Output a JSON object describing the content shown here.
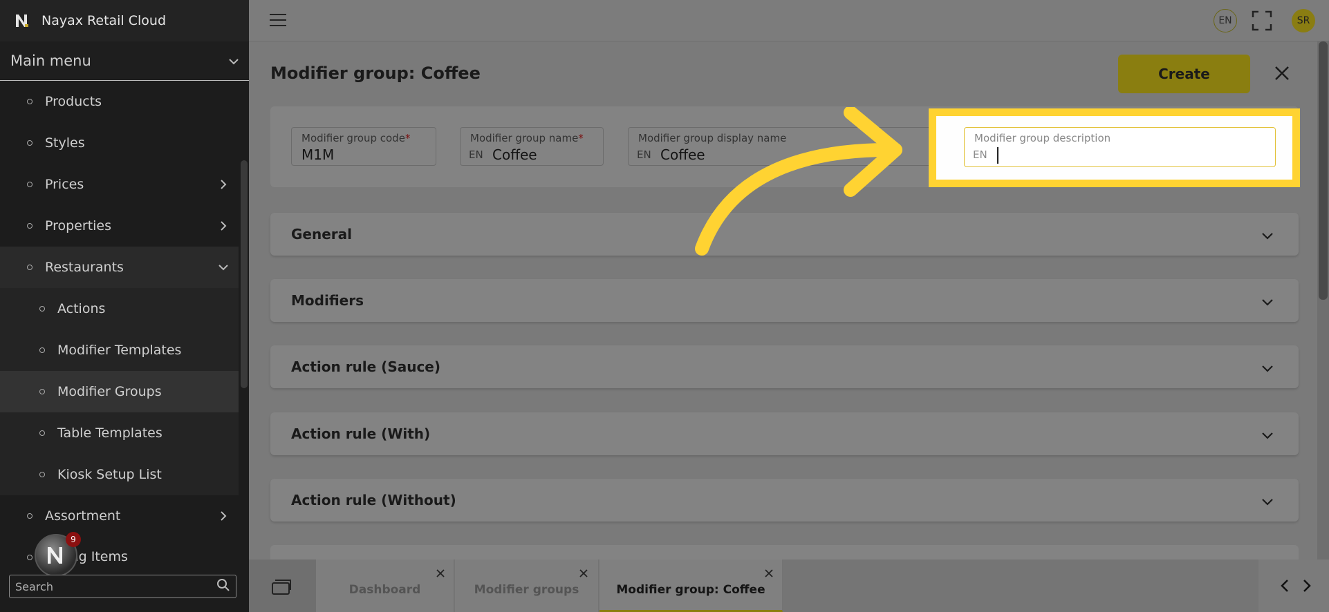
{
  "app": {
    "title": "Nayax Retail Cloud"
  },
  "sidebar": {
    "menu_label": "Main menu",
    "items": [
      {
        "label": "Products"
      },
      {
        "label": "Styles"
      },
      {
        "label": "Prices"
      },
      {
        "label": "Properties"
      },
      {
        "label": "Restaurants"
      },
      {
        "label": "Actions"
      },
      {
        "label": "Modifier Templates"
      },
      {
        "label": "Modifier Groups"
      },
      {
        "label": "Table Templates"
      },
      {
        "label": "Kiosk Setup List"
      },
      {
        "label": "Assortment"
      },
      {
        "label": "ling Items"
      }
    ],
    "search_placeholder": "Search",
    "notification_count": "9"
  },
  "topbar": {
    "language": "EN",
    "user_initials": "SR"
  },
  "page": {
    "title": "Modifier group: Coffee",
    "create_label": "Create",
    "fields": {
      "code": {
        "label": "Modifier group code",
        "required": "*",
        "value": "M1M"
      },
      "name": {
        "label": "Modifier group name",
        "required": "*",
        "prefix": "EN",
        "value": "Coffee"
      },
      "display_name": {
        "label": "Modifier group display name",
        "prefix": "EN",
        "value": "Coffee"
      },
      "description": {
        "label": "Modifier group description",
        "prefix": "EN",
        "value": ""
      }
    },
    "sections": [
      {
        "title": "General"
      },
      {
        "title": "Modifiers"
      },
      {
        "title": "Action rule (Sauce)"
      },
      {
        "title": "Action rule (With)"
      },
      {
        "title": "Action rule (Without)"
      }
    ]
  },
  "tabs": [
    {
      "label": "Dashboard"
    },
    {
      "label": "Modifier groups"
    },
    {
      "label": "Modifier group: Coffee"
    }
  ],
  "colors": {
    "accent": "#ffd332",
    "highlight_border": "#ffd332",
    "create_button": "#8a7e10"
  }
}
